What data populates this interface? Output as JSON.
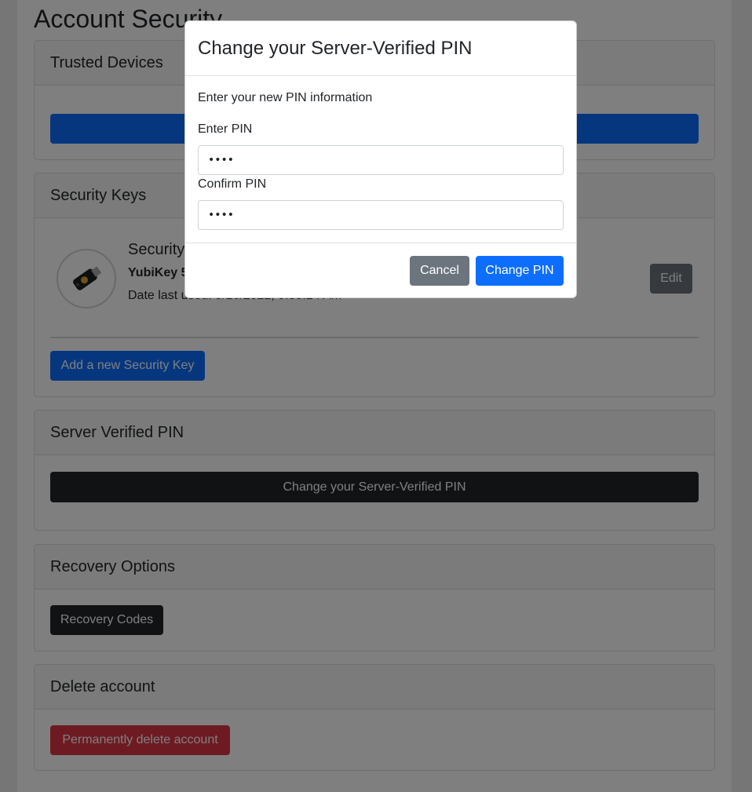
{
  "page": {
    "title": "Account Security"
  },
  "trusted_devices": {
    "header": "Trusted Devices"
  },
  "security_keys": {
    "header": "Security Keys",
    "key": {
      "icon": "usb-security-key-icon",
      "name": "Security",
      "model": "YubiKey 5",
      "date_last_used": "Date last used: 5/16/2022, 9:58:24 AM",
      "edit_label": "Edit"
    },
    "add_label": "Add a new Security Key"
  },
  "server_pin": {
    "header": "Server Verified PIN",
    "change_label": "Change your Server-Verified PIN"
  },
  "recovery": {
    "header": "Recovery Options",
    "codes_label": "Recovery Codes"
  },
  "delete_account": {
    "header": "Delete account",
    "delete_label": "Permanently delete account"
  },
  "modal": {
    "title": "Change your Server-Verified PIN",
    "intro": "Enter your new PIN information",
    "enter_pin_label": "Enter PIN",
    "enter_pin_value": "••••",
    "confirm_pin_label": "Confirm PIN",
    "confirm_pin_value": "••••",
    "cancel_label": "Cancel",
    "submit_label": "Change PIN"
  },
  "colors": {
    "primary": "#0d6efd",
    "dark": "#212529",
    "secondary": "#6c757d",
    "danger": "#dc3545",
    "backdrop": "rgba(0,0,0,0.5)"
  }
}
